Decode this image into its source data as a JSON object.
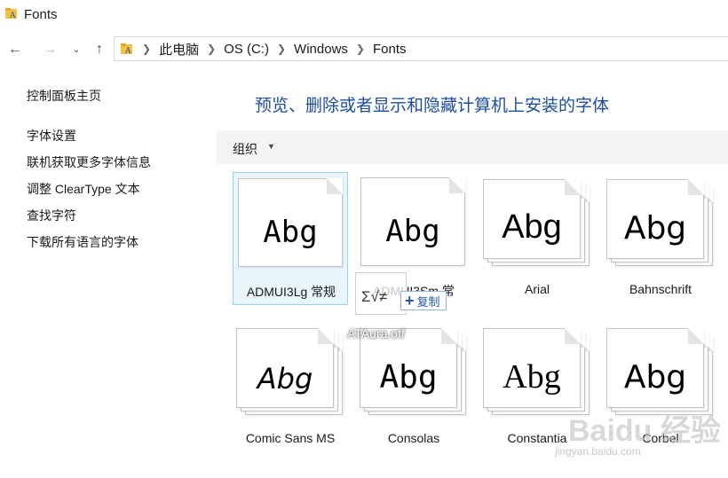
{
  "window": {
    "title": "Fonts"
  },
  "nav": {
    "back": "←",
    "forward": "→",
    "recent": "⌄",
    "up": "↑"
  },
  "breadcrumb": [
    "此电脑",
    "OS (C:)",
    "Windows",
    "Fonts"
  ],
  "left_pane": {
    "items": [
      "控制面板主页",
      "字体设置",
      "联机获取更多字体信息",
      "调整 ClearType 文本",
      "查找字符",
      "下载所有语言的字体"
    ]
  },
  "main": {
    "heading": "预览、删除或者显示和隐藏计算机上安装的字体"
  },
  "toolbar": {
    "organize": "组织",
    "organize_caret": "▼"
  },
  "fonts": [
    {
      "name": "ADMUI3Lg 常规",
      "sample": "Abg",
      "stacked": false,
      "selected": true
    },
    {
      "name": "ADMUI3Sm 常",
      "sample": "Abg",
      "stacked": false,
      "selected": false
    },
    {
      "name": "Arial",
      "sample": "Abg",
      "stacked": true,
      "selected": false
    },
    {
      "name": "Bahnschrift",
      "sample": "Abg",
      "stacked": true,
      "selected": false
    },
    {
      "name": "Comic Sans MS",
      "sample": "Abg",
      "stacked": true,
      "selected": false
    },
    {
      "name": "Consolas",
      "sample": "Abg",
      "stacked": true,
      "selected": false
    },
    {
      "name": "Constantia",
      "sample": "Abg",
      "stacked": true,
      "selected": false
    },
    {
      "name": "Corbel",
      "sample": "Abg",
      "stacked": true,
      "selected": false
    }
  ],
  "drag": {
    "ghost_text": "Σ√≠",
    "copy_label": "复制",
    "plus": "+",
    "file_name": "ATAura.otf"
  },
  "watermark": {
    "brand": "Baidu 经验",
    "url": "jingyan.baidu.com"
  },
  "colors": {
    "heading": "#1e4ea0",
    "selection_border": "#99d1f0",
    "toolbar_bg": "#f3f4f6",
    "copy_blue": "#1e5aa8"
  }
}
